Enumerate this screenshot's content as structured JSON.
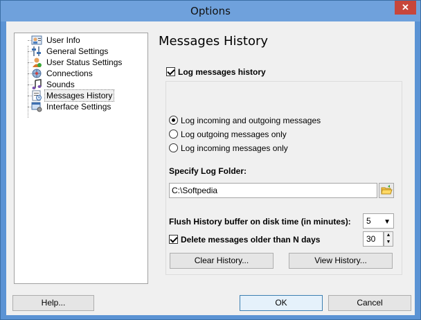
{
  "window": {
    "title": "Options",
    "close": "✕"
  },
  "tree": {
    "items": [
      {
        "label": "User Info",
        "icon": "user-card-icon",
        "selected": false
      },
      {
        "label": "General Settings",
        "icon": "sliders-icon",
        "selected": false
      },
      {
        "label": "User Status Settings",
        "icon": "user-status-icon",
        "selected": false
      },
      {
        "label": "Connections",
        "icon": "network-icon",
        "selected": false
      },
      {
        "label": "Sounds",
        "icon": "music-note-icon",
        "selected": false
      },
      {
        "label": "Messages History",
        "icon": "history-icon",
        "selected": true
      },
      {
        "label": "Interface Settings",
        "icon": "interface-icon",
        "selected": false
      }
    ]
  },
  "panel": {
    "title": "Messages History",
    "log_history": {
      "label": "Log messages history",
      "checked": true
    },
    "radios": [
      {
        "label": "Log incoming and outgoing messages",
        "checked": true
      },
      {
        "label": "Log outgoing messages only",
        "checked": false
      },
      {
        "label": "Log incoming messages only",
        "checked": false
      }
    ],
    "folder": {
      "label": "Specify Log Folder:",
      "value": "C:\\Softpedia"
    },
    "flush": {
      "label": "Flush History buffer on disk time (in minutes):",
      "value": "5"
    },
    "delete_old": {
      "label": "Delete messages older than N days",
      "checked": true,
      "value": "30"
    },
    "clear_button": "Clear History...",
    "view_button": "View History..."
  },
  "footer": {
    "help": "Help...",
    "ok": "OK",
    "cancel": "Cancel"
  }
}
